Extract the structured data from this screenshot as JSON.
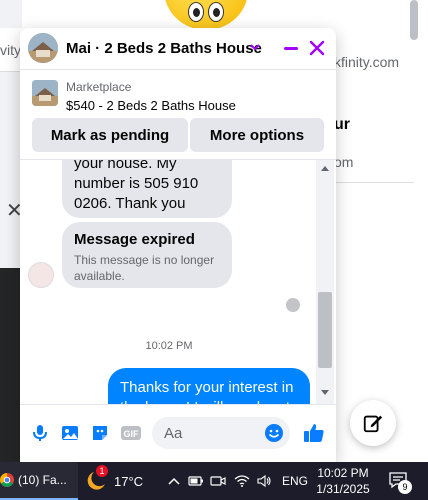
{
  "background": {
    "left_text": "vity",
    "right_link": "kfinity.com",
    "right_heading": "ur",
    "right_text": "om"
  },
  "chat": {
    "title": "Mai · 2 Beds 2 Baths House",
    "marketplace": {
      "label": "Marketplace",
      "listing": "$540 - 2 Beds 2 Baths House",
      "pending_button": "Mark as pending",
      "more_button": "More options"
    },
    "messages": {
      "incoming_text": "your house. My number is 505 910 0206. Thank you",
      "expired_title": "Message expired",
      "expired_body": "This message is no longer available.",
      "timestamp": "10:02 PM",
      "outgoing_text": "Thanks for your interest in the house! I will reach out"
    },
    "composer": {
      "placeholder": "Aa"
    }
  },
  "taskbar": {
    "app_label": "(10) Fa...",
    "weather_badge": "1",
    "temperature": "17°C",
    "language": "ENG",
    "time": "10:02 PM",
    "date": "1/31/2025",
    "notification_count": "9"
  },
  "colors": {
    "accent_purple": "#a100ff",
    "messenger_blue": "#0084ff",
    "like_blue": "#0a7cff",
    "taskbar_bg": "#1c1c2a"
  }
}
